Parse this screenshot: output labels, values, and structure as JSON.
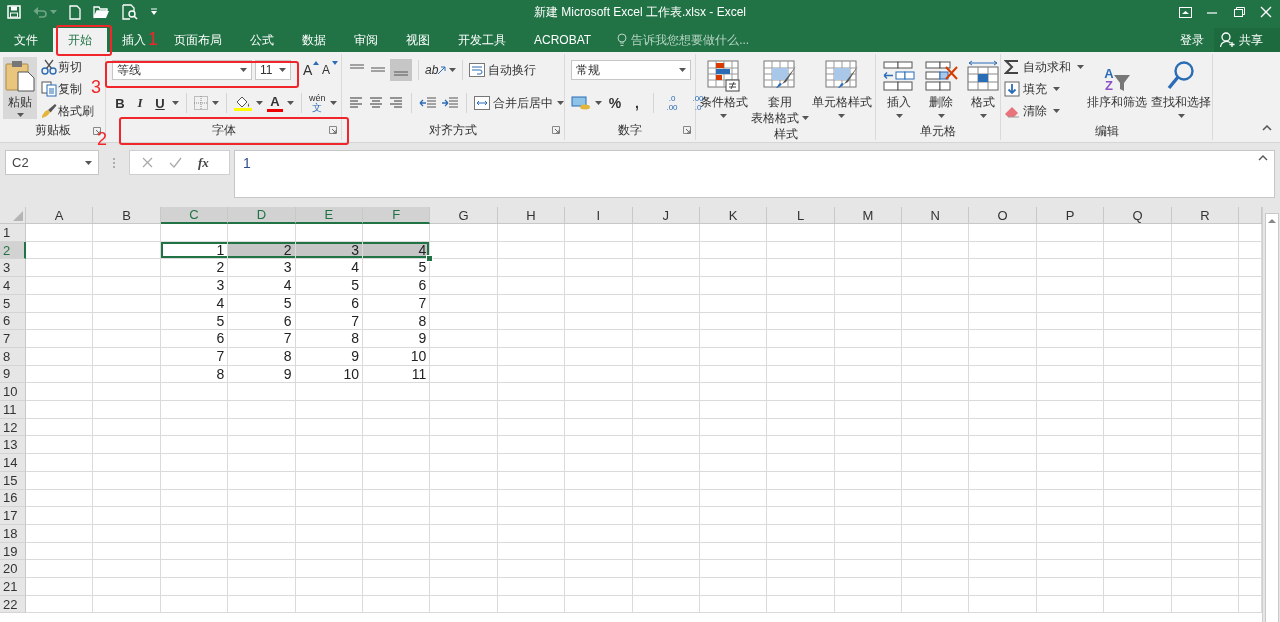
{
  "window": {
    "title": "新建 Microsoft Excel 工作表.xlsx - Excel"
  },
  "tabs": [
    {
      "label": "文件",
      "selected": false
    },
    {
      "label": "开始",
      "selected": true
    },
    {
      "label": "插入",
      "selected": false
    },
    {
      "label": "页面布局",
      "selected": false
    },
    {
      "label": "公式",
      "selected": false
    },
    {
      "label": "数据",
      "selected": false
    },
    {
      "label": "审阅",
      "selected": false
    },
    {
      "label": "视图",
      "selected": false
    },
    {
      "label": "开发工具",
      "selected": false
    },
    {
      "label": "ACROBAT",
      "selected": false
    }
  ],
  "tell_me": {
    "placeholder": "告诉我您想要做什么..."
  },
  "account": {
    "sign_in": "登录",
    "share": "共享"
  },
  "ribbon": {
    "groups": [
      {
        "kind": "clipboard",
        "label": "剪贴板",
        "launcher": true,
        "paste": "粘贴",
        "commands": [
          "剪切",
          "复制",
          "格式刷"
        ]
      },
      {
        "kind": "font",
        "label": "字体",
        "launcher": true,
        "font": "等线",
        "size": "11",
        "grow": "A",
        "shrink": "A",
        "styles": [
          "B",
          "I",
          "U"
        ],
        "color_letter": "A",
        "phonetic": [
          "wén",
          "文"
        ]
      },
      {
        "kind": "alignment",
        "label": "对齐方式",
        "launcher": true,
        "orientation": "ab",
        "commands": [
          "自动换行",
          "合并后居中"
        ]
      },
      {
        "kind": "number",
        "label": "数字",
        "launcher": true,
        "format": "常规",
        "symbols": [
          "%",
          ","
        ],
        "decimals": [
          [
            ".0",
            ".00"
          ],
          [
            ".00",
            ".0"
          ]
        ]
      },
      {
        "kind": "large",
        "label": "样式",
        "launcher": false,
        "buttons": [
          {
            "lines": [
              "条件格式"
            ],
            "dropdown": true
          },
          {
            "lines": [
              "套用",
              "表格格式"
            ],
            "dropdown": true
          },
          {
            "lines": [
              "单元格样式"
            ],
            "dropdown": true
          }
        ]
      },
      {
        "kind": "large",
        "label": "单元格",
        "launcher": false,
        "buttons": [
          {
            "lines": [
              "插入"
            ],
            "dropdown": true
          },
          {
            "lines": [
              "删除"
            ],
            "dropdown": true
          },
          {
            "lines": [
              "格式"
            ],
            "dropdown": true
          }
        ]
      },
      {
        "kind": "editing",
        "label": "编辑",
        "launcher": false,
        "commands": [
          "自动求和",
          "填充",
          "清除"
        ],
        "sort_letters": [
          "A",
          "Z"
        ],
        "buttons": [
          {
            "lines": [
              "排序和筛选"
            ],
            "dropdown": false
          },
          {
            "lines": [
              "查找和选择"
            ],
            "dropdown": true
          }
        ]
      }
    ]
  },
  "formula_bar": {
    "name_box": "C2",
    "insert_function": "fx",
    "value": "1"
  },
  "sheet": {
    "columns": [
      {
        "label": "A",
        "selected": false
      },
      {
        "label": "B",
        "selected": false
      },
      {
        "label": "C",
        "selected": true
      },
      {
        "label": "D",
        "selected": true
      },
      {
        "label": "E",
        "selected": true
      },
      {
        "label": "F",
        "selected": true
      },
      {
        "label": "G",
        "selected": false
      },
      {
        "label": "H",
        "selected": false
      },
      {
        "label": "I",
        "selected": false
      },
      {
        "label": "J",
        "selected": false
      },
      {
        "label": "K",
        "selected": false
      },
      {
        "label": "L",
        "selected": false
      },
      {
        "label": "M",
        "selected": false
      },
      {
        "label": "N",
        "selected": false
      },
      {
        "label": "O",
        "selected": false
      },
      {
        "label": "P",
        "selected": false
      },
      {
        "label": "Q",
        "selected": false
      },
      {
        "label": "R",
        "selected": false
      }
    ],
    "rows": [
      {
        "label": "1",
        "selected": false
      },
      {
        "label": "2",
        "selected": true,
        "cells": [
          null,
          null,
          {
            "value": "1",
            "active": true,
            "selected": false
          },
          {
            "value": "2",
            "active": false,
            "selected": true
          },
          {
            "value": "3",
            "active": false,
            "selected": true
          },
          {
            "value": "4",
            "active": false,
            "selected": true
          }
        ]
      },
      {
        "label": "3",
        "selected": false,
        "cells": [
          null,
          null,
          {
            "value": "2",
            "active": false,
            "selected": false
          },
          {
            "value": "3",
            "active": false,
            "selected": false
          },
          {
            "value": "4",
            "active": false,
            "selected": false
          },
          {
            "value": "5",
            "active": false,
            "selected": false
          }
        ]
      },
      {
        "label": "4",
        "selected": false,
        "cells": [
          null,
          null,
          {
            "value": "3",
            "active": false,
            "selected": false
          },
          {
            "value": "4",
            "active": false,
            "selected": false
          },
          {
            "value": "5",
            "active": false,
            "selected": false
          },
          {
            "value": "6",
            "active": false,
            "selected": false
          }
        ]
      },
      {
        "label": "5",
        "selected": false,
        "cells": [
          null,
          null,
          {
            "value": "4",
            "active": false,
            "selected": false
          },
          {
            "value": "5",
            "active": false,
            "selected": false
          },
          {
            "value": "6",
            "active": false,
            "selected": false
          },
          {
            "value": "7",
            "active": false,
            "selected": false
          }
        ]
      },
      {
        "label": "6",
        "selected": false,
        "cells": [
          null,
          null,
          {
            "value": "5",
            "active": false,
            "selected": false
          },
          {
            "value": "6",
            "active": false,
            "selected": false
          },
          {
            "value": "7",
            "active": false,
            "selected": false
          },
          {
            "value": "8",
            "active": false,
            "selected": false
          }
        ]
      },
      {
        "label": "7",
        "selected": false,
        "cells": [
          null,
          null,
          {
            "value": "6",
            "active": false,
            "selected": false
          },
          {
            "value": "7",
            "active": false,
            "selected": false
          },
          {
            "value": "8",
            "active": false,
            "selected": false
          },
          {
            "value": "9",
            "active": false,
            "selected": false
          }
        ]
      },
      {
        "label": "8",
        "selected": false,
        "cells": [
          null,
          null,
          {
            "value": "7",
            "active": false,
            "selected": false
          },
          {
            "value": "8",
            "active": false,
            "selected": false
          },
          {
            "value": "9",
            "active": false,
            "selected": false
          },
          {
            "value": "10",
            "active": false,
            "selected": false
          }
        ]
      },
      {
        "label": "9",
        "selected": false,
        "cells": [
          null,
          null,
          {
            "value": "8",
            "active": false,
            "selected": false
          },
          {
            "value": "9",
            "active": false,
            "selected": false
          },
          {
            "value": "10",
            "active": false,
            "selected": false
          },
          {
            "value": "11",
            "active": false,
            "selected": false
          }
        ]
      },
      {
        "label": "10",
        "selected": false
      },
      {
        "label": "11",
        "selected": false
      },
      {
        "label": "12",
        "selected": false
      },
      {
        "label": "13",
        "selected": false
      },
      {
        "label": "14",
        "selected": false
      },
      {
        "label": "15",
        "selected": false
      },
      {
        "label": "16",
        "selected": false
      },
      {
        "label": "17",
        "selected": false
      },
      {
        "label": "18",
        "selected": false
      },
      {
        "label": "19",
        "selected": false
      },
      {
        "label": "20",
        "selected": false
      },
      {
        "label": "21",
        "selected": false
      },
      {
        "label": "22",
        "selected": false
      }
    ]
  },
  "annotations": [
    {
      "number": "1"
    },
    {
      "number": "2"
    },
    {
      "number": "3"
    }
  ]
}
